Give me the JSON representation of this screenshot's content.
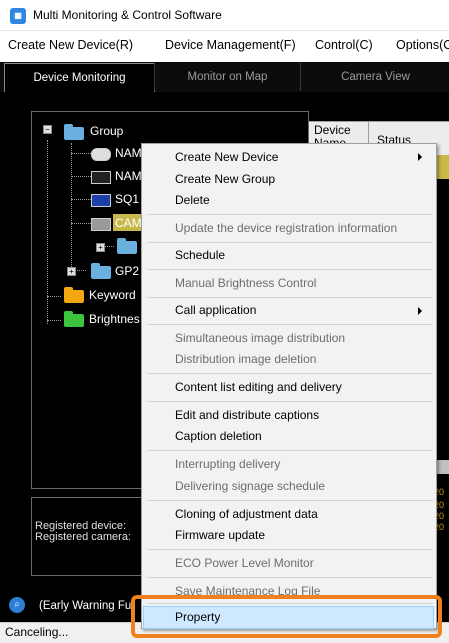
{
  "window": {
    "title": "Multi Monitoring & Control Software",
    "app_icon": "app-logo-icon"
  },
  "menubar": {
    "items": [
      "Create New Device(R)",
      "Device Management(F)",
      "Control(C)",
      "Options(C"
    ]
  },
  "tabs": [
    {
      "label": "Device Monitoring",
      "active": true
    },
    {
      "label": "Monitor on Map",
      "active": false
    },
    {
      "label": "Camera View",
      "active": false
    }
  ],
  "tree": {
    "root": "Group",
    "children": [
      "NAM",
      "NAM",
      "SQ1",
      "CAM",
      "",
      "GP2"
    ],
    "keyword": "Keyword",
    "brightness": "Brightnes"
  },
  "table": {
    "col_device": "Device Name",
    "col_status": "Status"
  },
  "info": {
    "registered_device": "Registered device:",
    "registered_camera": "Registered camera:"
  },
  "right_times": [
    "20",
    "20",
    "20",
    "20"
  ],
  "bottom_bar": {
    "text": "(Early Warning Fu"
  },
  "statusbar": {
    "text": "Canceling..."
  },
  "context_menu": {
    "items": [
      {
        "label": "Create New Device",
        "enabled": true,
        "submenu": true
      },
      {
        "label": "Create New Group",
        "enabled": true
      },
      {
        "label": "Delete",
        "enabled": true
      },
      {
        "label": "Update the device registration information",
        "enabled": false
      },
      {
        "label": "Schedule",
        "enabled": true
      },
      {
        "label": "Manual Brightness Control",
        "enabled": false
      },
      {
        "label": "Call application",
        "enabled": true,
        "submenu": true
      },
      {
        "label": "Simultaneous image distribution",
        "enabled": false
      },
      {
        "label": "Distribution image deletion",
        "enabled": false
      },
      {
        "label": "Content list editing and delivery",
        "enabled": true
      },
      {
        "label": "Edit and distribute captions",
        "enabled": true
      },
      {
        "label": "Caption deletion",
        "enabled": true
      },
      {
        "label": "Interrupting delivery",
        "enabled": false
      },
      {
        "label": "Delivering signage schedule",
        "enabled": false
      },
      {
        "label": "Cloning of adjustment data",
        "enabled": true
      },
      {
        "label": "Firmware update",
        "enabled": true
      },
      {
        "label": "ECO Power Level Monitor",
        "enabled": false
      },
      {
        "label": "Save Maintenance Log File",
        "enabled": false
      },
      {
        "label": "Property",
        "enabled": true,
        "highlighted": true
      }
    ]
  },
  "colors": {
    "highlight_box": "#f0821e",
    "selected_item": "#cde8ff",
    "tree_selected": "#c8b84a"
  }
}
